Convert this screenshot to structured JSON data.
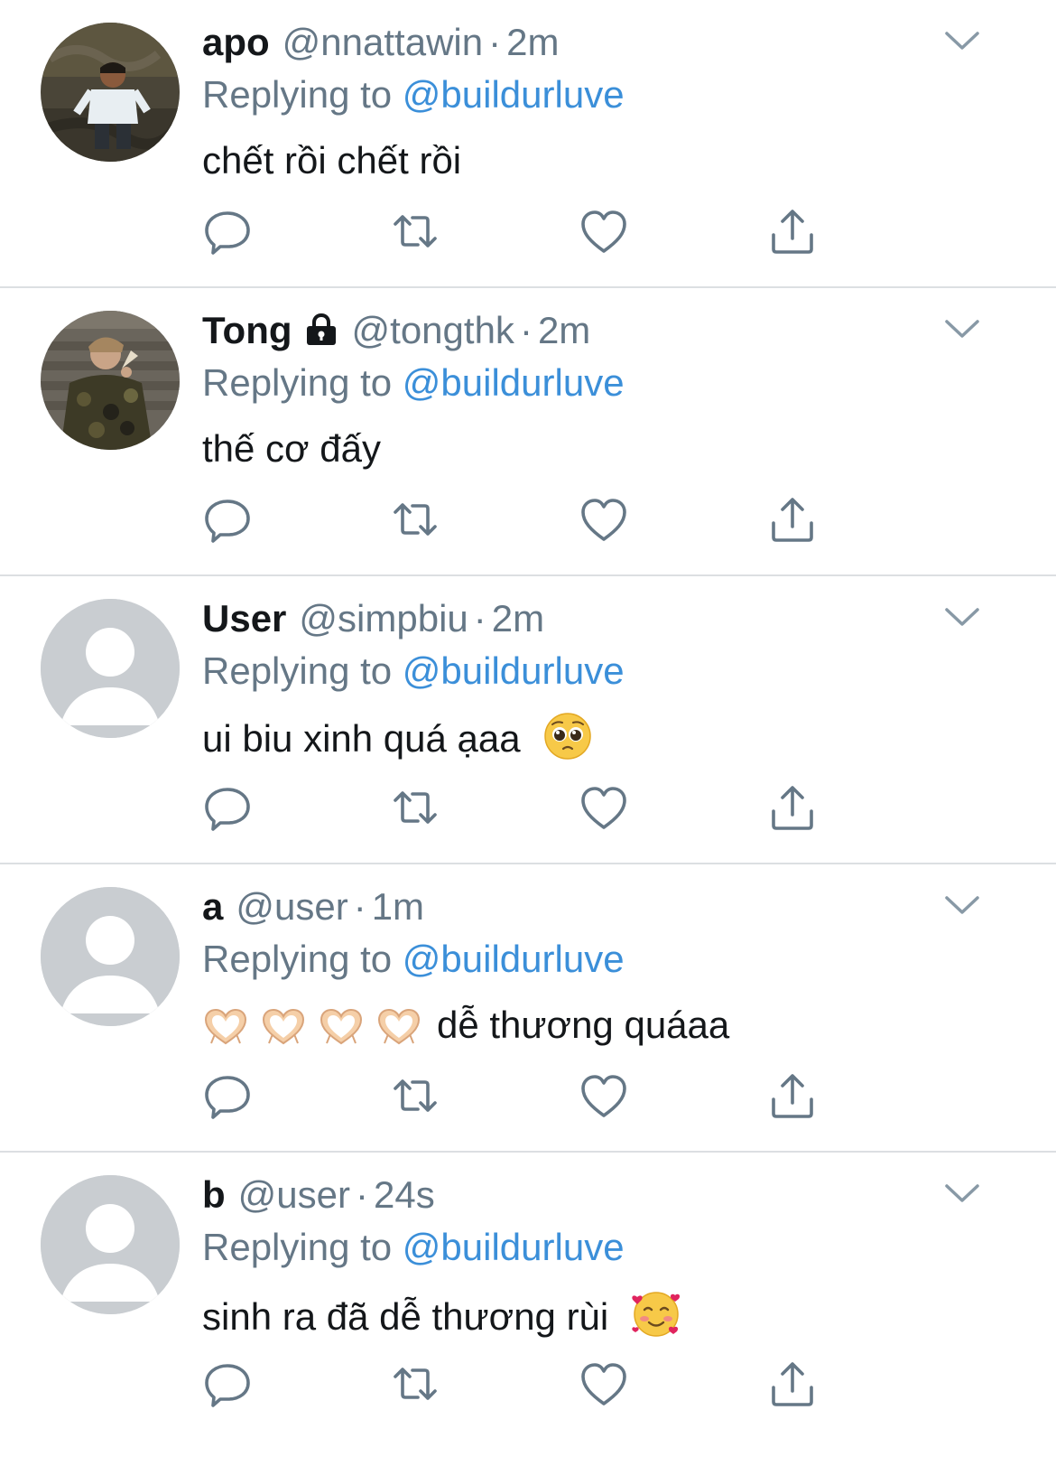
{
  "colors": {
    "name": "#14171a",
    "secondary": "#657786",
    "mention": "#3b8fd9",
    "icon": "#657786",
    "divider": "#dcdfe2",
    "default_avatar_bg": "#c9cdd1"
  },
  "tweets": [
    {
      "name": "apo",
      "locked": false,
      "handle": "@nnattawin",
      "separator": "·",
      "time": "2m",
      "replying_prefix": "Replying to",
      "replying_to": "@buildurluve",
      "text": "chết rồi chết rồi",
      "emoji": [],
      "avatar": "photo-person-in-water"
    },
    {
      "name": "Tong",
      "locked": true,
      "handle": "@tongthk",
      "separator": "·",
      "time": "2m",
      "replying_prefix": "Replying to",
      "replying_to": "@buildurluve",
      "text": "thế cơ đấy",
      "emoji": [],
      "avatar": "photo-person-camo-jacket"
    },
    {
      "name": "User",
      "locked": false,
      "handle": "@simpbiu",
      "separator": "·",
      "time": "2m",
      "replying_prefix": "Replying to",
      "replying_to": "@buildurluve",
      "text": "ui biu xinh quá ạaa",
      "emoji": [
        "pleading-face"
      ],
      "avatar": "default-avatar"
    },
    {
      "name": "a",
      "locked": false,
      "handle": "@user",
      "separator": "·",
      "time": "1m",
      "replying_prefix": "Replying to",
      "replying_to": "@buildurluve",
      "text": "dễ thương quáaa",
      "emoji": [
        "heart-hands",
        "heart-hands",
        "heart-hands",
        "heart-hands"
      ],
      "avatar": "default-avatar"
    },
    {
      "name": "b",
      "locked": false,
      "handle": "@user",
      "separator": "·",
      "time": "24s",
      "replying_prefix": "Replying to",
      "replying_to": "@buildurluve",
      "text": "sinh ra đã dễ thương rùi",
      "emoji": [
        "smiling-face-with-hearts"
      ],
      "avatar": "default-avatar"
    }
  ],
  "icons": {
    "more": "chevron-down-icon",
    "reply": "reply-bubble-icon",
    "retweet": "retweet-icon",
    "like": "heart-icon",
    "share": "share-icon",
    "locked": "lock-icon"
  }
}
